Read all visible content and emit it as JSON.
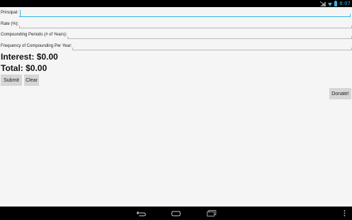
{
  "status_bar": {
    "time": "8:07",
    "icons": [
      "no-signal-icon",
      "wifi-icon",
      "battery-icon"
    ],
    "time_color": "#33b5e5"
  },
  "form": {
    "principal": {
      "label": "Principal:",
      "value": ""
    },
    "rate": {
      "label": "Rate (%):",
      "value": ""
    },
    "periods": {
      "label": "Compounding Periods (# of Years):",
      "value": ""
    },
    "frequency": {
      "label": "Frequency of Compounding Per Year:",
      "value": ""
    }
  },
  "results": {
    "interest": "Interest: $0.00",
    "total": "Total: $0.00"
  },
  "buttons": {
    "submit": "Submit",
    "clear": "Clear",
    "donate": "Donate!"
  },
  "nav_bar": {
    "icons": [
      "back-icon",
      "home-icon",
      "recent-apps-icon",
      "menu-icon"
    ]
  },
  "colors": {
    "accent": "#33b5e5",
    "background": "#f5f5f5",
    "button": "#d6d6d6"
  }
}
